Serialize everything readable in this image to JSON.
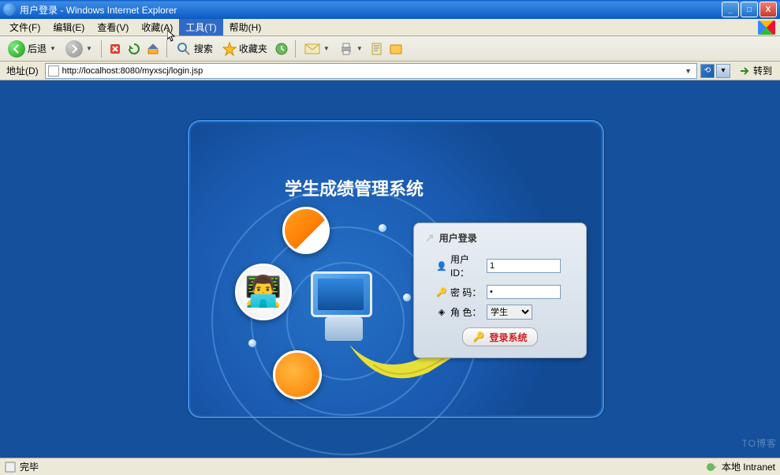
{
  "window": {
    "title": "用户登录 - Windows Internet Explorer",
    "min": "_",
    "max": "□",
    "close": "X"
  },
  "menu": {
    "file": "文件(F)",
    "edit": "编辑(E)",
    "view": "查看(V)",
    "favorites": "收藏(A)",
    "tools": "工具(T)",
    "help": "帮助(H)"
  },
  "toolbar": {
    "back": "后退",
    "search": "搜索",
    "favorites": "收藏夹"
  },
  "address": {
    "label": "地址(D)",
    "url": "http://localhost:8080/myxscj/login.jsp",
    "go": "转到"
  },
  "app": {
    "title": "学生成绩管理系统"
  },
  "login": {
    "panel_title": "用户登录",
    "user_label": "用户ID：",
    "user_value": "1",
    "pwd_label": "密 码：",
    "pwd_value": "•",
    "role_label": "角 色：",
    "role_value": "学生",
    "submit": "登录系统"
  },
  "status": {
    "done": "完毕",
    "zone": "本地 Intranet"
  },
  "watermark": "TO博客"
}
